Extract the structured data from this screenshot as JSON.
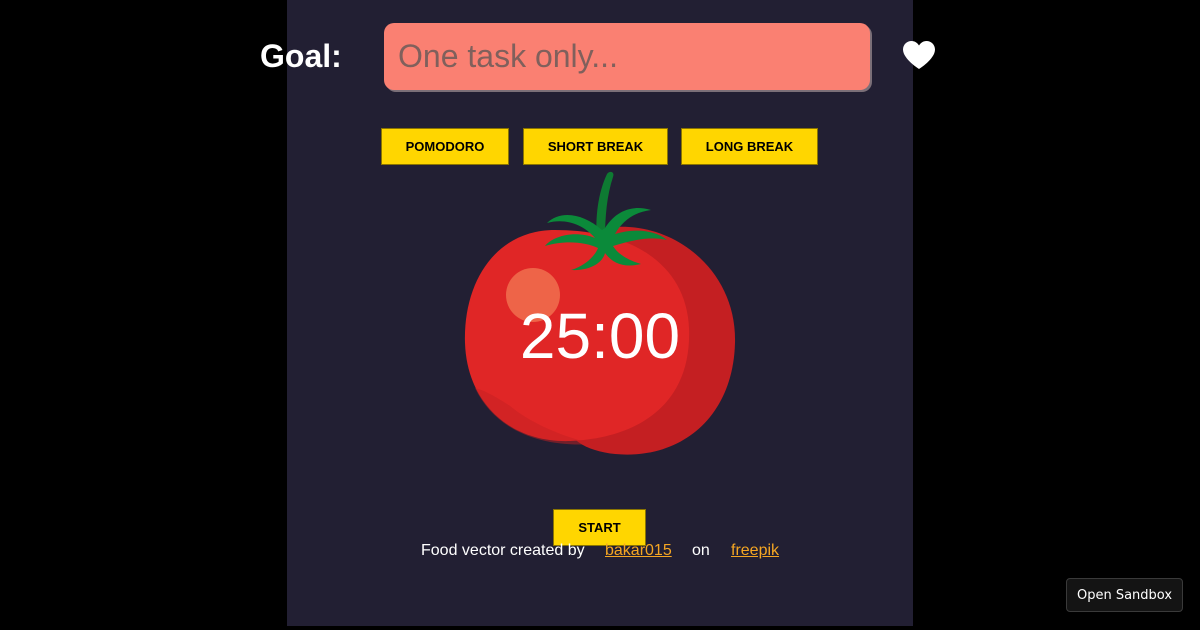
{
  "goal": {
    "label": "Goal:",
    "placeholder": "One task only...",
    "value": ""
  },
  "favorite_icon": "heart-icon",
  "modes": {
    "pomodoro_label": "POMODORO",
    "short_break_label": "SHORT BREAK",
    "long_break_label": "LONG BREAK"
  },
  "timer": {
    "display": "25:00",
    "illustration": "tomato"
  },
  "controls": {
    "start_label": "START"
  },
  "credit": {
    "text": "Food vector created by",
    "author": "bakar015",
    "on": "on",
    "site": "freepik"
  },
  "sandbox": {
    "open_label": "Open Sandbox"
  },
  "colors": {
    "background": "#000000",
    "panel": "#221f33",
    "accent_button": "#ffd600",
    "input": "#fa8072",
    "link": "#f5a623",
    "tomato_red": "#e02626",
    "leaf_green": "#0b8a3a"
  }
}
